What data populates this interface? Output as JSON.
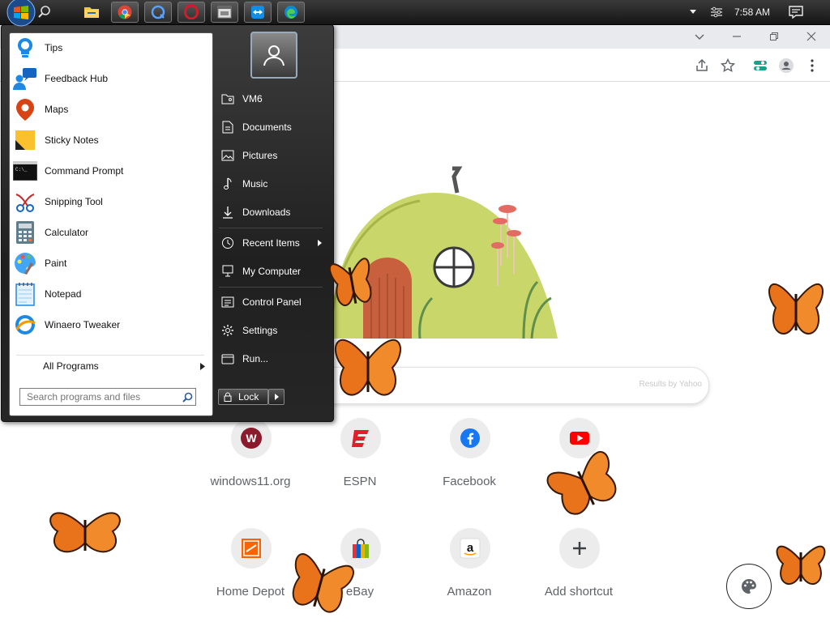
{
  "taskbar": {
    "clock": "7:58 AM",
    "apps": [
      {
        "name": "file-explorer"
      },
      {
        "name": "chrome"
      },
      {
        "name": "quicktime"
      },
      {
        "name": "opera"
      },
      {
        "name": "app-window"
      },
      {
        "name": "teamviewer"
      },
      {
        "name": "edge"
      }
    ]
  },
  "start_menu": {
    "pinned": [
      {
        "label": "Tips",
        "icon": "tips-icon"
      },
      {
        "label": "Feedback Hub",
        "icon": "feedback-hub-icon"
      },
      {
        "label": "Maps",
        "icon": "maps-icon"
      },
      {
        "label": "Sticky Notes",
        "icon": "sticky-notes-icon"
      },
      {
        "label": "Command Prompt",
        "icon": "command-prompt-icon"
      },
      {
        "label": "Snipping Tool",
        "icon": "snipping-tool-icon"
      },
      {
        "label": "Calculator",
        "icon": "calculator-icon"
      },
      {
        "label": "Paint",
        "icon": "paint-icon"
      },
      {
        "label": "Notepad",
        "icon": "notepad-icon"
      },
      {
        "label": "Winaero Tweaker",
        "icon": "winaero-tweaker-icon"
      }
    ],
    "all_programs": "All Programs",
    "search_placeholder": "Search programs and files",
    "right": {
      "vm6": "VM6",
      "documents": "Documents",
      "pictures": "Pictures",
      "music": "Music",
      "downloads": "Downloads",
      "recent_items": "Recent Items",
      "my_computer": "My Computer",
      "control_panel": "Control Panel",
      "settings": "Settings",
      "run": "Run..."
    },
    "lock": "Lock"
  },
  "browser": {
    "search_provider": "Results by Yahoo",
    "shortcuts": [
      {
        "label": "windows11.org"
      },
      {
        "label": "ESPN"
      },
      {
        "label": "Facebook"
      },
      {
        "label": "YouTube"
      },
      {
        "label": "Home Depot"
      },
      {
        "label": "eBay"
      },
      {
        "label": "Amazon"
      },
      {
        "label": "Add shortcut"
      }
    ]
  },
  "colors": {
    "taskbar": "#1f1f1f",
    "start_left": "#ffffff",
    "start_right": "#2a2a2a",
    "butterfly": "#e8731a"
  }
}
